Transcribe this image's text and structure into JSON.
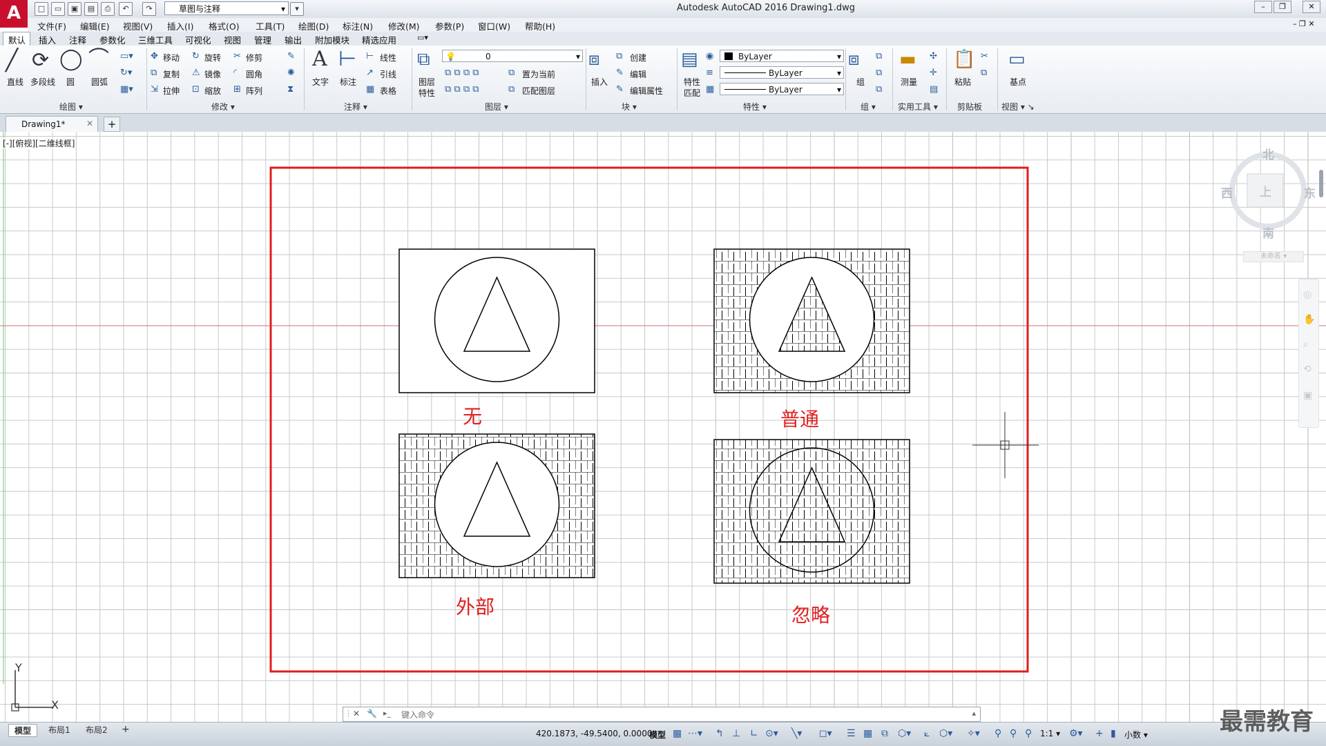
{
  "app": {
    "logo": "A",
    "title": "Autodesk AutoCAD 2016    Drawing1.dwg"
  },
  "quick_access": {
    "workspace": "草图与注释"
  },
  "menu": [
    "文件(F)",
    "编辑(E)",
    "视图(V)",
    "插入(I)",
    "格式(O)",
    "工具(T)",
    "绘图(D)",
    "标注(N)",
    "修改(M)",
    "参数(P)",
    "窗口(W)",
    "帮助(H)"
  ],
  "ribbon_tabs": [
    "默认",
    "插入",
    "注释",
    "参数化",
    "三维工具",
    "可视化",
    "视图",
    "管理",
    "输出",
    "附加模块",
    "精选应用"
  ],
  "ribbon": {
    "draw": {
      "title": "绘图",
      "line": "直线",
      "polyline": "多段线",
      "circle": "圆",
      "arc": "圆弧"
    },
    "modify": {
      "title": "修改",
      "move": "移动",
      "rotate": "旋转",
      "trim": "修剪",
      "copy": "复制",
      "mirror": "镜像",
      "fillet": "圆角",
      "stretch": "拉伸",
      "scale": "缩放",
      "array": "阵列"
    },
    "annotation": {
      "title": "注释",
      "text": "文字",
      "dimension": "标注",
      "linear": "线性",
      "leader": "引线",
      "table": "表格"
    },
    "layers": {
      "title": "图层",
      "layer_props": "图层",
      "layer_props2": "特性",
      "current_layer": "0",
      "make_current": "置为当前",
      "match_layer": "匹配图层"
    },
    "block": {
      "title": "块",
      "insert": "插入",
      "create": "创建",
      "edit": "编辑",
      "edit_attr": "编辑属性"
    },
    "properties": {
      "title": "特性",
      "match": "特性",
      "match2": "匹配",
      "color": "ByLayer",
      "linetype": "ByLayer",
      "lineweight": "ByLayer"
    },
    "groups": {
      "title": "组",
      "group": "组"
    },
    "utilities": {
      "title": "实用工具",
      "measure": "测量"
    },
    "clipboard": {
      "title": "剪贴板",
      "paste": "粘贴"
    },
    "view": {
      "title": "视图",
      "base": "基点"
    }
  },
  "document_tab": {
    "name": "Drawing1*"
  },
  "viewport": {
    "label": "[-][俯视][二维线框]"
  },
  "hatch_labels": {
    "none": "无",
    "normal": "普通",
    "outer": "外部",
    "ignore": "忽略"
  },
  "view_cube": {
    "north": "北",
    "south": "南",
    "west": "西",
    "east": "东",
    "top": "上",
    "wcs": "未命名"
  },
  "ucs": {
    "x": "X",
    "y": "Y"
  },
  "layout_tabs": [
    "模型",
    "布局1",
    "布局2"
  ],
  "command_line": {
    "placeholder": "键入命令"
  },
  "status": {
    "coords": "420.1873, -49.5400, 0.0000",
    "space": "模型",
    "scale": "1:1",
    "units": "小数"
  },
  "watermark": "最需教育"
}
